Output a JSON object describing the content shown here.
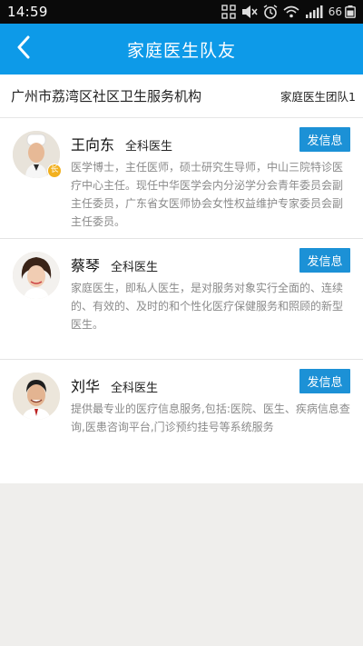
{
  "status_bar": {
    "time": "14:59",
    "battery": "66",
    "icons": [
      "screen-icon",
      "mute-icon",
      "alarm-icon",
      "wifi-icon",
      "signal-icon",
      "battery-icon"
    ]
  },
  "header": {
    "title": "家庭医生队友",
    "back_icon": "chevron-left-icon",
    "background": "#0d9ae8"
  },
  "org": {
    "name": "广州市荔湾区社区卫生服务机构",
    "team": "家庭医生团队1"
  },
  "doctors": [
    {
      "name": "王向东",
      "title": "全科医生",
      "badge": "长",
      "button": "发信息",
      "description": "医学博士，主任医师，硕士研究生导师，中山三院特诊医疗中心主任。现任中华医学会内分泌学分会青年委员会副主任委员，广东省女医师协会女性权益维护专家委员会副主任委员。"
    },
    {
      "name": "蔡琴",
      "title": "全科医生",
      "button": "发信息",
      "description": "家庭医生，即私人医生，是对服务对象实行全面的、连续的、有效的、及时的和个性化医疗保健服务和照顾的新型医生。"
    },
    {
      "name": "刘华",
      "title": "全科医生",
      "button": "发信息",
      "description": "提供最专业的医疗信息服务,包括:医院、医生、疾病信息查询,医患咨询平台,门诊预约挂号等系统服务"
    }
  ],
  "colors": {
    "accent": "#0d9ae8",
    "button": "#1c91d6",
    "badge": "#f2b01e"
  }
}
